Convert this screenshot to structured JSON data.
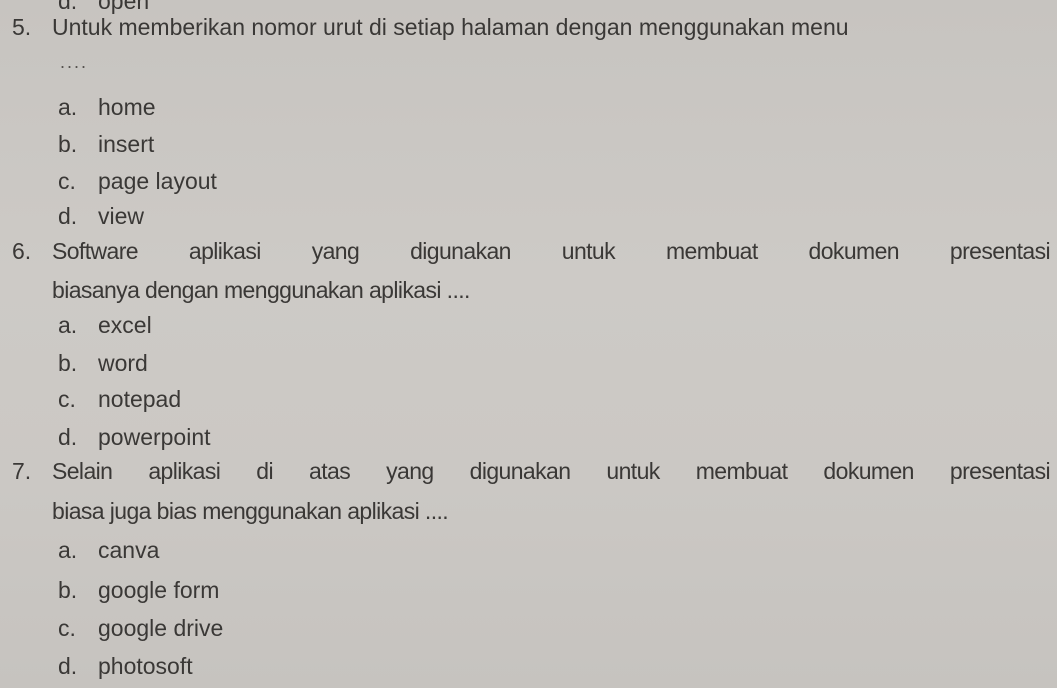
{
  "previous_option": {
    "letter": "d.",
    "text": "open"
  },
  "questions": [
    {
      "number": "5.",
      "line1": "Untuk memberikan nomor urut di setiap halaman dengan menggunakan menu",
      "line2": "....",
      "options": [
        {
          "letter": "a.",
          "text": "home"
        },
        {
          "letter": "b.",
          "text": "insert"
        },
        {
          "letter": "c.",
          "text": "page layout"
        },
        {
          "letter": "d.",
          "text": "view"
        }
      ]
    },
    {
      "number": "6.",
      "line1": "Software aplikasi yang digunakan untuk membuat dokumen presentasi",
      "line2": "biasanya dengan menggunakan aplikasi ....",
      "options": [
        {
          "letter": "a.",
          "text": "excel"
        },
        {
          "letter": "b.",
          "text": "word"
        },
        {
          "letter": "c.",
          "text": "notepad"
        },
        {
          "letter": "d.",
          "text": "powerpoint"
        }
      ]
    },
    {
      "number": "7.",
      "line1": "Selain aplikasi di atas yang digunakan untuk membuat dokumen presentasi",
      "line2": "biasa juga bias menggunakan aplikasi ....",
      "options": [
        {
          "letter": "a.",
          "text": "canva"
        },
        {
          "letter": "b.",
          "text": "google form"
        },
        {
          "letter": "c.",
          "text": "google drive"
        },
        {
          "letter": "d.",
          "text": "photosoft"
        }
      ]
    }
  ]
}
